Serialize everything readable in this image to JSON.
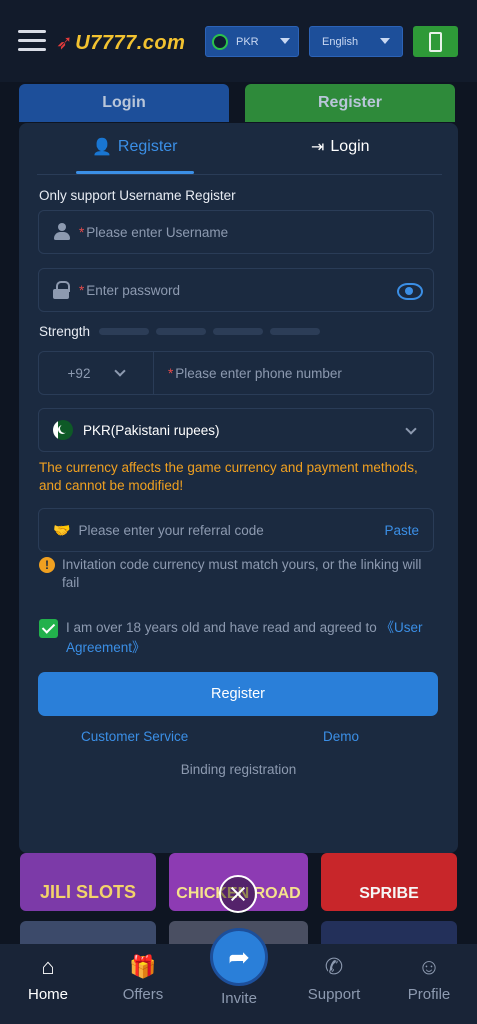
{
  "header": {
    "logo_text": "U7777.com",
    "currency_pill": "PKR",
    "language_pill": "English"
  },
  "page_tabs": {
    "login_label": "Login",
    "register_label": "Register"
  },
  "modal": {
    "tab_register": "Register",
    "tab_login": "Login",
    "hint": "Only support Username Register",
    "username_placeholder": "Please enter Username",
    "password_placeholder": "Enter password",
    "strength_label": "Strength",
    "phone_country_code": "+92",
    "phone_placeholder": "Please enter phone number",
    "currency_value": "PKR(Pakistani rupees)",
    "currency_warning": "The currency affects the game currency and payment methods, and cannot be modified!",
    "referral_placeholder": "Please enter your referral code",
    "paste_label": "Paste",
    "invite_note": "Invitation code currency must match yours, or the linking will fail",
    "agreement_text": "I am over 18 years old and have read and agreed to ",
    "agreement_link": "《User Agreement》",
    "agreement_checked": true,
    "register_button": "Register",
    "customer_service": "Customer Service",
    "demo": "Demo",
    "binding_registration": "Binding registration"
  },
  "games": {
    "tile1": "JILI SLOTS",
    "tile2": "CHICKEN ROAD",
    "tile3": "SPRIBE"
  },
  "bottom_nav": {
    "home": "Home",
    "offers": "Offers",
    "invite": "Invite",
    "support": "Support",
    "profile": "Profile"
  },
  "colors": {
    "accent_blue": "#2a7fd9",
    "register_green": "#2e8a3a",
    "warning_orange": "#f0a020",
    "required_red": "#e34a4a"
  }
}
